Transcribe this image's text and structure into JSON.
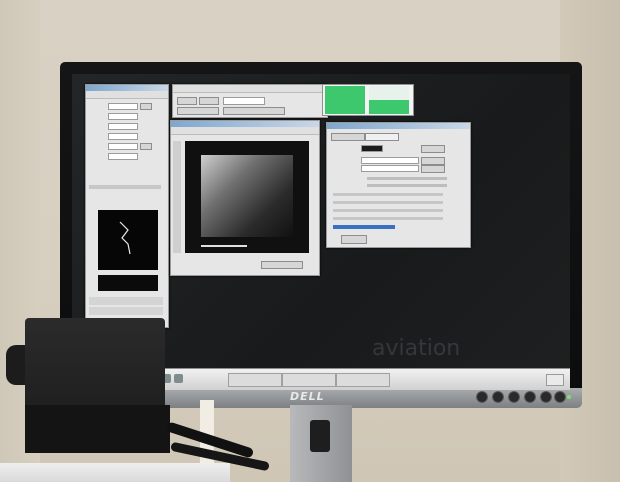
{
  "monitor": {
    "brand": "DELL"
  },
  "screen": {
    "watermark_text": "aviation",
    "status_panel": {
      "cells": [
        {
          "label": "",
          "color": "#3ec86e"
        },
        {
          "label": "",
          "color": "#e8f2ec"
        },
        {
          "label": "",
          "color": "#3ec86e"
        },
        {
          "label": "",
          "color": "#3ec86e"
        }
      ]
    }
  },
  "colors": {
    "bezel": "#111111",
    "screen_bg": "#1e2021",
    "window_bg": "#e6e6e6",
    "titlebar": "#7ea7cf",
    "status_green": "#3ec86e",
    "progress_blue": "#3a6fc4"
  },
  "icons": {
    "power": "power-icon",
    "taskbar_start": "start-menu-icon"
  }
}
